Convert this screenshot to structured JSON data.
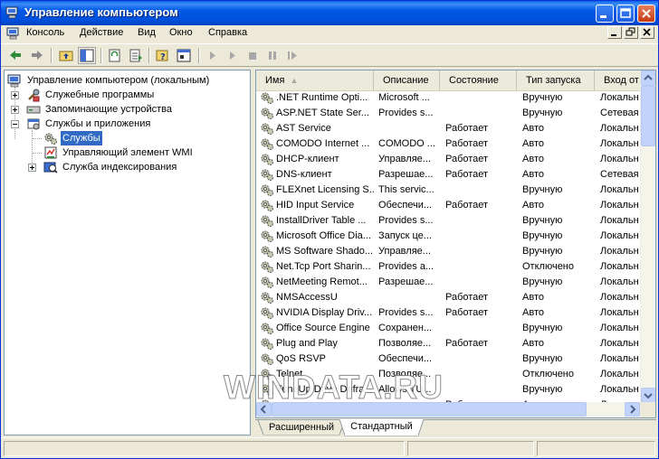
{
  "window": {
    "title": "Управление компьютером"
  },
  "menu": {
    "items": [
      "Консоль",
      "Действие",
      "Вид",
      "Окно",
      "Справка"
    ]
  },
  "tree": {
    "root": "Управление компьютером (локальным)",
    "items": [
      {
        "label": "Служебные программы",
        "level": 1,
        "expander": "plus"
      },
      {
        "label": "Запоминающие устройства",
        "level": 1,
        "expander": "plus"
      },
      {
        "label": "Службы и приложения",
        "level": 1,
        "expander": "minus"
      },
      {
        "label": "Службы",
        "level": 2,
        "expander": "none",
        "selected": true
      },
      {
        "label": "Управляющий элемент WMI",
        "level": 2,
        "expander": "none"
      },
      {
        "label": "Служба индексирования",
        "level": 2,
        "expander": "plus"
      }
    ]
  },
  "list": {
    "columns": [
      "Имя",
      "Описание",
      "Состояние",
      "Тип запуска",
      "Вход от"
    ],
    "rows": [
      [
        ".NET Runtime Opti...",
        "Microsoft ...",
        "",
        "Вручную",
        "Локальн"
      ],
      [
        "ASP.NET State Ser...",
        "Provides s...",
        "",
        "Вручную",
        "Сетевая"
      ],
      [
        "AST Service",
        "",
        "Работает",
        "Авто",
        "Локальн"
      ],
      [
        "COMODO Internet ...",
        "COMODO ...",
        "Работает",
        "Авто",
        "Локальн"
      ],
      [
        "DHCP-клиент",
        "Управляе...",
        "Работает",
        "Авто",
        "Локальн"
      ],
      [
        "DNS-клиент",
        "Разрешае...",
        "Работает",
        "Авто",
        "Сетевая"
      ],
      [
        "FLEXnet Licensing S...",
        "This servic...",
        "",
        "Вручную",
        "Локальн"
      ],
      [
        "HID Input Service",
        "Обеспечи...",
        "Работает",
        "Авто",
        "Локальн"
      ],
      [
        "InstallDriver Table ...",
        "Provides s...",
        "",
        "Вручную",
        "Локальн"
      ],
      [
        "Microsoft Office Dia...",
        "Запуск це...",
        "",
        "Вручную",
        "Локальн"
      ],
      [
        "MS Software Shado...",
        "Управляе...",
        "",
        "Вручную",
        "Локальн"
      ],
      [
        "Net.Tcp Port Sharin...",
        "Provides a...",
        "",
        "Отключено",
        "Локальн"
      ],
      [
        "NetMeeting Remot...",
        "Разрешае...",
        "",
        "Вручную",
        "Локальн"
      ],
      [
        "NMSAccessU",
        "",
        "Работает",
        "Авто",
        "Локальн"
      ],
      [
        "NVIDIA Display Driv...",
        "Provides s...",
        "Работает",
        "Авто",
        "Локальн"
      ],
      [
        "Office Source Engine",
        "Сохранен...",
        "",
        "Вручную",
        "Локальн"
      ],
      [
        "Plug and Play",
        "Позволяе...",
        "Работает",
        "Авто",
        "Локальн"
      ],
      [
        "QoS RSVP",
        "Обеспечи...",
        "",
        "Вручную",
        "Локальн"
      ],
      [
        "Telnet",
        "Позволяе...",
        "",
        "Отключено",
        "Локальн"
      ],
      [
        "TuneUp Drive Defra...",
        "Allows TU...",
        "",
        "Вручную",
        "Локальн"
      ],
      [
        "",
        "",
        "Работает",
        "Авто",
        "Локальн"
      ]
    ]
  },
  "tabs": [
    "Расширенный",
    "Стандартный"
  ],
  "active_tab": "Стандартный",
  "watermark": "WINDATA.RU",
  "colors": {
    "titlebar": "#0058e6",
    "selection": "#316ac5",
    "face": "#ece9d8"
  }
}
